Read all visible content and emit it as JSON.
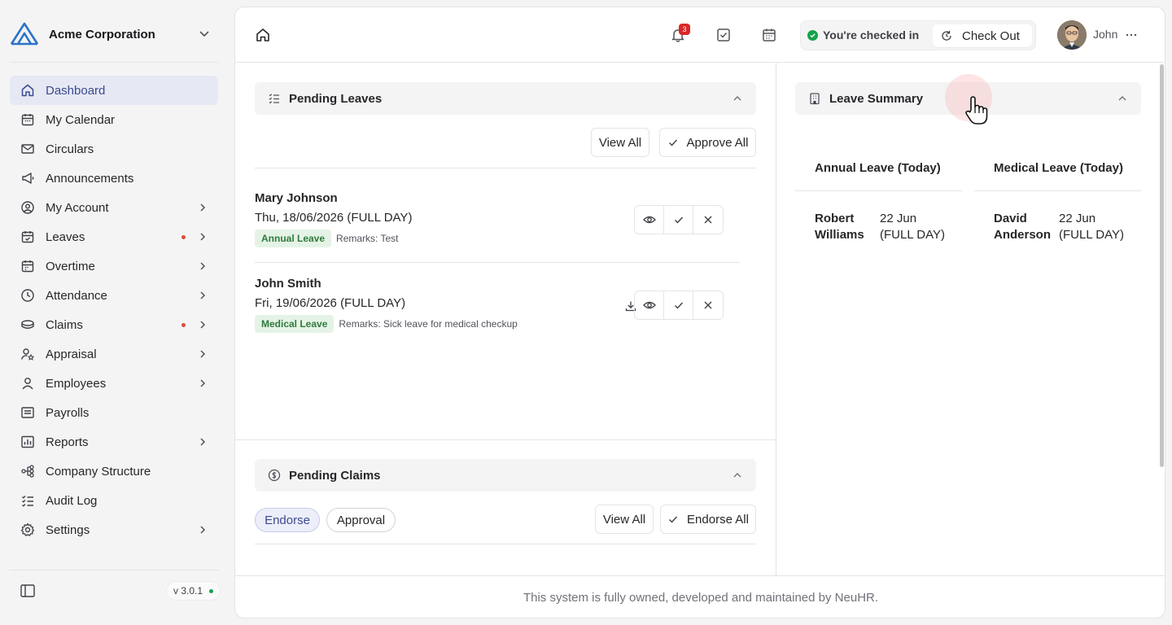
{
  "sidebar": {
    "org_name": "Acme Corporation",
    "items": [
      {
        "label": "Dashboard",
        "icon": "home-icon",
        "active": true,
        "has_arrow": false,
        "has_dot": false
      },
      {
        "label": "My Calendar",
        "icon": "calendar-icon",
        "has_arrow": false,
        "has_dot": false
      },
      {
        "label": "Circulars",
        "icon": "mail-icon",
        "has_arrow": false,
        "has_dot": false
      },
      {
        "label": "Announcements",
        "icon": "megaphone-icon",
        "has_arrow": false,
        "has_dot": false
      },
      {
        "label": "My Account",
        "icon": "user-circle-icon",
        "has_arrow": true,
        "has_dot": false
      },
      {
        "label": "Leaves",
        "icon": "calendar-check-icon",
        "has_arrow": true,
        "has_dot": true
      },
      {
        "label": "Overtime",
        "icon": "calendar-clock-icon",
        "has_arrow": true,
        "has_dot": false
      },
      {
        "label": "Attendance",
        "icon": "clock-icon",
        "has_arrow": true,
        "has_dot": false
      },
      {
        "label": "Claims",
        "icon": "coins-icon",
        "has_arrow": true,
        "has_dot": true
      },
      {
        "label": "Appraisal",
        "icon": "user-star-icon",
        "has_arrow": true,
        "has_dot": false
      },
      {
        "label": "Employees",
        "icon": "user-icon",
        "has_arrow": true,
        "has_dot": false
      },
      {
        "label": "Payrolls",
        "icon": "receipt-icon",
        "has_arrow": false,
        "has_dot": false
      },
      {
        "label": "Reports",
        "icon": "chart-icon",
        "has_arrow": true,
        "has_dot": false
      },
      {
        "label": "Company Structure",
        "icon": "hierarchy-icon",
        "has_arrow": false,
        "has_dot": false
      },
      {
        "label": "Audit Log",
        "icon": "list-check-icon",
        "has_arrow": false,
        "has_dot": false
      },
      {
        "label": "Settings",
        "icon": "gear-icon",
        "has_arrow": true,
        "has_dot": false
      }
    ],
    "version": "v 3.0.1"
  },
  "topbar": {
    "notification_count": "3",
    "checkin_status": "You're checked in",
    "checkout_label": "Check Out",
    "user_name": "John"
  },
  "pending_leaves": {
    "title": "Pending Leaves",
    "view_all": "View All",
    "approve_all": "Approve All",
    "rows": [
      {
        "name": "Mary Johnson",
        "date": "Thu, 18/06/2026 (FULL DAY)",
        "type": "Annual Leave",
        "remarks": "Remarks: Test",
        "has_attachment": false
      },
      {
        "name": "John Smith",
        "date": "Fri, 19/06/2026 (FULL DAY)",
        "type": "Medical Leave",
        "remarks": "Remarks: Sick leave for medical checkup",
        "has_attachment": true
      }
    ]
  },
  "pending_claims": {
    "title": "Pending Claims",
    "tabs": [
      "Endorse",
      "Approval"
    ],
    "view_all": "View All",
    "endorse_all": "Endorse All"
  },
  "leave_summary": {
    "title": "Leave Summary",
    "columns": [
      {
        "heading": "Annual Leave (Today)",
        "entries": [
          {
            "employee": "Robert Williams",
            "when": "22 Jun (FULL DAY)"
          }
        ]
      },
      {
        "heading": "Medical Leave (Today)",
        "entries": [
          {
            "employee": "David Anderson",
            "when": "22 Jun (FULL DAY)"
          }
        ]
      }
    ]
  },
  "footer": {
    "text": "This system is fully owned, developed and maintained by NeuHR."
  },
  "colors": {
    "accent": "#3b4a8f",
    "active_nav_bg": "#e6e9f4",
    "checked_in_green": "#16a34a",
    "notification_red": "#dc2626",
    "leave_tag_bg": "#e5f3e6",
    "leave_tag_text": "#2f7a3b"
  }
}
